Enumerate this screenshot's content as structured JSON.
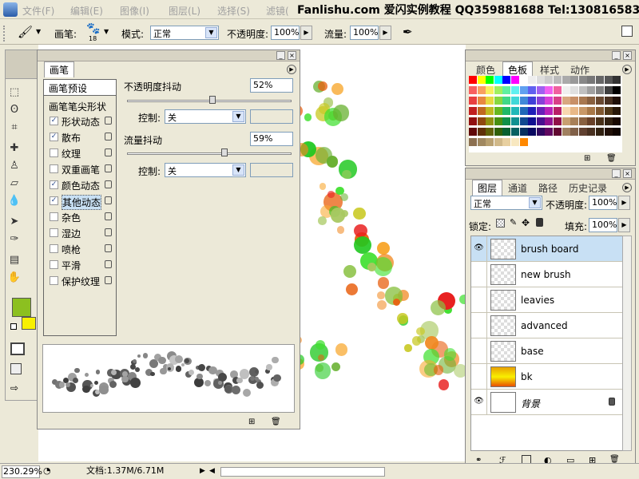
{
  "menubar": {
    "items": [
      "文件(F)",
      "编辑(E)",
      "图像(I)",
      "图层(L)",
      "选择(S)",
      "滤镜("
    ],
    "banner": "Fanlishu.com 爱闪实例教程 QQ359881688 Tel:13081658396"
  },
  "options": {
    "brush_label": "画笔:",
    "brush_size": "18",
    "mode_label": "模式:",
    "mode_value": "正常",
    "opacity_label": "不透明度:",
    "opacity_value": "100%",
    "flow_label": "流量:",
    "flow_value": "100%"
  },
  "brush_panel": {
    "title": "画笔",
    "tab_presets": "画笔预设",
    "tip_shape": "画笔笔尖形状",
    "items": [
      {
        "label": "形状动态",
        "checked": "✓"
      },
      {
        "label": "散布",
        "checked": "✓"
      },
      {
        "label": "纹理",
        "checked": ""
      },
      {
        "label": "双重画笔",
        "checked": ""
      },
      {
        "label": "颜色动态",
        "checked": "✓"
      },
      {
        "label": "其他动态",
        "checked": "✓"
      },
      {
        "label": "杂色",
        "checked": ""
      },
      {
        "label": "湿边",
        "checked": ""
      },
      {
        "label": "喷枪",
        "checked": ""
      },
      {
        "label": "平滑",
        "checked": ""
      },
      {
        "label": "保护纹理",
        "checked": ""
      }
    ],
    "opacity_jitter_label": "不透明度抖动",
    "opacity_jitter_value": "52%",
    "opacity_jitter_fraction": 0.52,
    "control_label": "控制:",
    "control_value": "关",
    "flow_jitter_label": "流量抖动",
    "flow_jitter_value": "59%",
    "flow_jitter_fraction": 0.59,
    "control2_label": "控制:",
    "control2_value": "关"
  },
  "swatch_panel": {
    "tabs": [
      "颜色",
      "色板",
      "样式",
      "动作"
    ],
    "active_tab": "色板"
  },
  "layers_panel": {
    "tabs": [
      "图层",
      "通道",
      "路径",
      "历史记录"
    ],
    "blend_mode": "正常",
    "opacity_label": "不透明度:",
    "opacity_value": "100%",
    "lock_label": "锁定:",
    "fill_label": "填充:",
    "fill_value": "100%",
    "layers": [
      {
        "name": "brush board",
        "visible": "👁",
        "selected": true
      },
      {
        "name": "new brush",
        "visible": "",
        "selected": false
      },
      {
        "name": "leavies",
        "visible": "",
        "selected": false
      },
      {
        "name": "advanced",
        "visible": "",
        "selected": false
      },
      {
        "name": "base",
        "visible": "",
        "selected": false
      },
      {
        "name": "bk",
        "visible": "",
        "selected": false
      },
      {
        "name": "背景",
        "visible": "👁",
        "selected": false
      }
    ]
  },
  "status": {
    "zoom": "230.29%",
    "doc_info": "文档:1.37M/6.71M"
  },
  "colors": {
    "foreground": "#8cc020",
    "background": "#f8f000",
    "selection": "#c8e0f4"
  }
}
